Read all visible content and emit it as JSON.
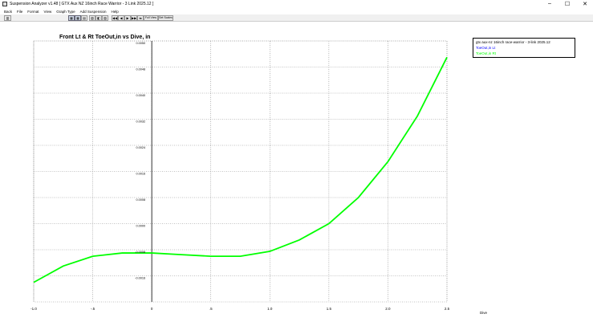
{
  "window": {
    "title": "Suspension Analyzer v1.48  [ GTX Aux NZ 16inch Race Warrior - 3 Link 2025.12 ]",
    "minimize_glyph": "–",
    "maximize_glyph": "☐",
    "close_glyph": "✕"
  },
  "menu": {
    "items": [
      "Back",
      "File",
      "Format",
      "View",
      "Graph Type",
      "Add Suspension",
      "Help"
    ]
  },
  "toolbar": {
    "full_view_label": "Full View",
    "set_scales_label": "Set Scales"
  },
  "legend": {
    "title": "gtx aux-nz 16inch race-warrior - 3-link 2025.12",
    "entries": [
      {
        "label": "ToeOut,in Lt",
        "color": "#0000ff"
      },
      {
        "label": "ToeOut,in Rt",
        "color": "#00ff00"
      }
    ]
  },
  "chart_data": {
    "type": "line",
    "title": "Front Lt & Rt ToeOut,in vs Dive, in",
    "xlabel": "Dive",
    "ylabel": "",
    "x_ticks": [
      "-1.0",
      "-.5",
      "0",
      ".5",
      "1.0",
      "1.5",
      "2.0",
      "2.5"
    ],
    "x_tick_values": [
      -1.0,
      -0.5,
      0,
      0.5,
      1.0,
      1.5,
      2.0,
      2.5
    ],
    "y_ticks": [
      "0.0050",
      "0.0048",
      "0.0040",
      "0.0032",
      "0.0024",
      "0.0016",
      "0.0008",
      "0.0000",
      "-0.0008",
      "-0.0016"
    ],
    "y_tick_values": [
      0.0056,
      0.0048,
      0.004,
      0.0032,
      0.0024,
      0.0016,
      0.0008,
      0.0,
      -0.0008,
      -0.0016
    ],
    "xlim": [
      -1.0,
      2.5
    ],
    "ylim": [
      -0.0024,
      0.0056
    ],
    "grid": true,
    "legend_position": "top-right",
    "series": [
      {
        "name": "ToeOut,in Rt",
        "color": "#00ff00",
        "x": [
          -1.0,
          -0.75,
          -0.5,
          -0.25,
          0.0,
          0.25,
          0.5,
          0.75,
          1.0,
          1.25,
          1.5,
          1.75,
          2.0,
          2.25,
          2.5
        ],
        "y": [
          -0.0018,
          -0.0013,
          -0.001,
          -0.0009,
          -0.0009,
          -0.00095,
          -0.001,
          -0.001,
          -0.00085,
          -0.0005,
          0.0,
          0.0008,
          0.0019,
          0.0033,
          0.0051
        ]
      }
    ]
  },
  "colors": {
    "grid": "#888888",
    "axis": "#000000",
    "series_rt": "#00ff00",
    "series_lt": "#0000ff"
  }
}
